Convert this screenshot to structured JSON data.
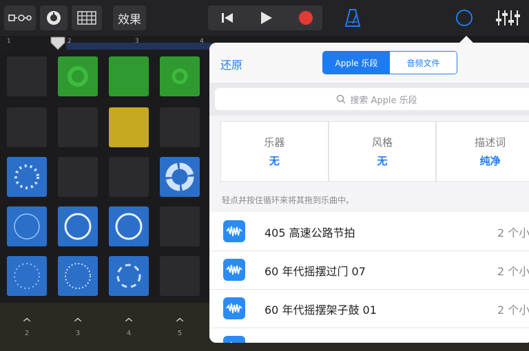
{
  "toolbar": {
    "fx_label": "效果",
    "icons": [
      "track-view-icon",
      "smart-controls-icon",
      "mixer-grid-icon",
      "rewind-icon",
      "play-icon",
      "record-icon",
      "metronome-icon",
      "loop-browser-icon",
      "settings-sliders-icon"
    ],
    "accent": "#1e7cf2",
    "record_color": "#e53935"
  },
  "ruler": {
    "ticks": [
      "1",
      "2",
      "3",
      "4"
    ]
  },
  "grid": {
    "colors": {
      "green": "#2f9a2f",
      "yellow": "#c7a821",
      "blue": "#2b6fc9"
    }
  },
  "bottom_bar": {
    "columns": [
      "2",
      "3",
      "4",
      "5"
    ]
  },
  "loop_browser": {
    "restore_label": "还原",
    "segments": [
      {
        "label": "Apple 乐段",
        "selected": true
      },
      {
        "label": "音频文件",
        "selected": false
      }
    ],
    "search_placeholder": "搜索 Apple 乐段",
    "filters": [
      {
        "label": "乐器",
        "value": "无"
      },
      {
        "label": "风格",
        "value": "无"
      },
      {
        "label": "描述词",
        "value": "纯净"
      }
    ],
    "hint": "轻点并按住循环来将其拖到乐曲中。",
    "items": [
      {
        "name": "405 高速公路节拍",
        "count": "2 个小"
      },
      {
        "name": "60 年代摇摆过门 07",
        "count": "2 个小"
      },
      {
        "name": "60 年代摇摆架子鼓 01",
        "count": "2 个小"
      }
    ]
  }
}
